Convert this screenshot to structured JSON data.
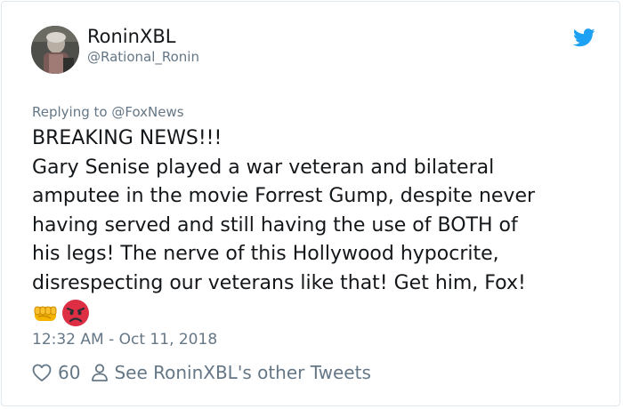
{
  "author": {
    "display_name": "RoninXBL",
    "handle": "@Rational_Ronin"
  },
  "reply": {
    "prefix": "Replying to",
    "to": "@FoxNews"
  },
  "tweet": {
    "lines": [
      "BREAKING NEWS!!!",
      "Gary Senise played a war veteran and bilateral",
      "amputee in the movie Forrest Gump, despite never",
      "having served and still having the use of BOTH of",
      "his legs! The nerve of this Hollywood hypocrite,",
      "disrespecting our veterans like that! Get him, Fox!"
    ],
    "emojis": [
      "fist-emoji",
      "angry-face-emoji"
    ]
  },
  "timestamp": "12:32 AM - Oct 11, 2018",
  "actions": {
    "likes": "60",
    "other_tweets": "See RoninXBL's other Tweets"
  },
  "icons": {
    "brand": "twitter-bird-icon",
    "like": "heart-icon",
    "profile": "person-icon"
  },
  "colors": {
    "twitter_blue": "#1da1f2",
    "secondary_text": "#657786",
    "primary_text": "#14171a",
    "border": "#e1e8ed"
  }
}
